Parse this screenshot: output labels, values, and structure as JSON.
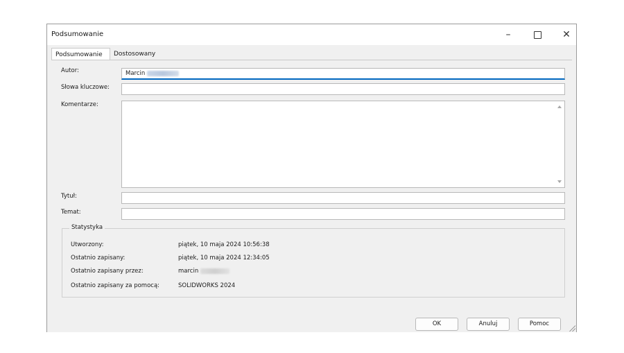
{
  "window": {
    "title": "Podsumowanie",
    "controls": {
      "minimize": "–",
      "close": "✕"
    }
  },
  "tabs": [
    {
      "label": "Podsumowanie",
      "active": true
    },
    {
      "label": "Dostosowany",
      "active": false
    }
  ],
  "form": {
    "author_label": "Autor:",
    "author_value": "Marcin",
    "keywords_label": "Słowa kluczowe:",
    "keywords_value": "",
    "comments_label": "Komentarze:",
    "comments_value": "",
    "title_label": "Tytuł:",
    "title_value": "",
    "subject_label": "Temat:",
    "subject_value": ""
  },
  "stats": {
    "legend": "Statystyka",
    "rows": [
      {
        "label": "Utworzony:",
        "value": "piątek, 10 maja 2024 10:56:38"
      },
      {
        "label": "Ostatnio zapisany:",
        "value": "piątek, 10 maja 2024 12:34:05"
      },
      {
        "label": "Ostatnio zapisany przez:",
        "value": "marcin"
      },
      {
        "label": "Ostatnio zapisany za pomocą:",
        "value": "SOLIDWORKS 2024"
      }
    ]
  },
  "buttons": {
    "ok": "OK",
    "cancel": "Anuluj",
    "help": "Pomoc"
  },
  "colors": {
    "focus_accent": "#0067c0",
    "dialog_bg": "#f0f0f0"
  }
}
